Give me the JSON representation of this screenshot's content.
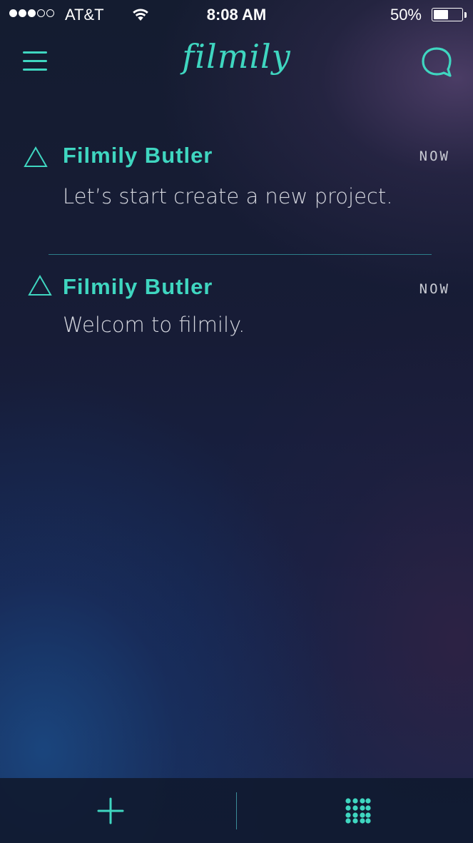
{
  "status_bar": {
    "signal_strength": 3,
    "signal_max": 5,
    "carrier": "AT&T",
    "time": "8:08 AM",
    "battery_percent": "50%",
    "battery_level": 0.5
  },
  "header": {
    "logo": "filmily",
    "menu_icon": "hamburger-menu-icon",
    "chat_icon": "chat-bubble-icon"
  },
  "messages": [
    {
      "sender": "Filmily Butler",
      "time": "NOW",
      "text": "Let’s start create a new project.",
      "icon": "triangle-icon"
    },
    {
      "sender": "Filmily Butler",
      "time": "NOW",
      "text": "Welcom to filmily.",
      "icon": "triangle-icon"
    }
  ],
  "bottom_bar": {
    "add_icon": "plus-icon",
    "grid_icon": "grid-dots-icon"
  },
  "colors": {
    "accent": "#3fd6c0",
    "text_primary": "#d4d6de",
    "background_dark": "#141c30"
  }
}
